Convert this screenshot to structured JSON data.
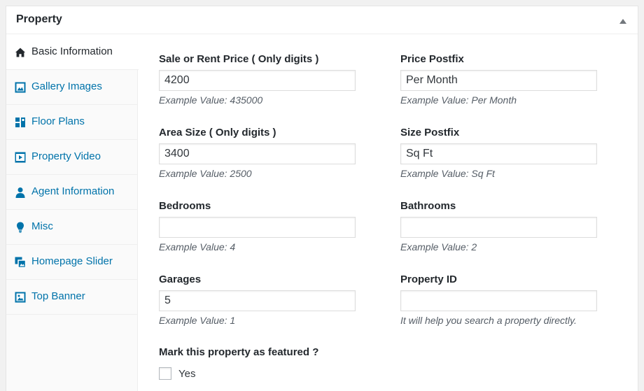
{
  "metabox": {
    "title": "Property"
  },
  "tabs": [
    {
      "label": "Basic Information",
      "icon": "home-icon",
      "active": true
    },
    {
      "label": "Gallery Images",
      "icon": "gallery-icon",
      "active": false
    },
    {
      "label": "Floor Plans",
      "icon": "floor-plan-icon",
      "active": false
    },
    {
      "label": "Property Video",
      "icon": "video-icon",
      "active": false
    },
    {
      "label": "Agent Information",
      "icon": "user-icon",
      "active": false
    },
    {
      "label": "Misc",
      "icon": "lightbulb-icon",
      "active": false
    },
    {
      "label": "Homepage Slider",
      "icon": "slider-icon",
      "active": false
    },
    {
      "label": "Top Banner",
      "icon": "image-icon",
      "active": false
    }
  ],
  "fields": {
    "price": {
      "label": "Sale or Rent Price ( Only digits )",
      "value": "4200",
      "hint": "Example Value: 435000"
    },
    "price_postfix": {
      "label": "Price Postfix",
      "value": "Per Month",
      "hint": "Example Value: Per Month"
    },
    "area": {
      "label": "Area Size ( Only digits )",
      "value": "3400",
      "hint": "Example Value: 2500"
    },
    "size_postfix": {
      "label": "Size Postfix",
      "value": "Sq Ft",
      "hint": "Example Value: Sq Ft"
    },
    "bedrooms": {
      "label": "Bedrooms",
      "value": "",
      "hint": "Example Value: 4"
    },
    "bathrooms": {
      "label": "Bathrooms",
      "value": "",
      "hint": "Example Value: 2"
    },
    "garages": {
      "label": "Garages",
      "value": "5",
      "hint": "Example Value: 1"
    },
    "property_id": {
      "label": "Property ID",
      "value": "",
      "hint": "It will help you search a property directly."
    }
  },
  "featured": {
    "label": "Mark this property as featured ?",
    "option": "Yes",
    "checked": false
  },
  "colors": {
    "link": "#0073aa",
    "text": "#23282d",
    "hint": "#555d66"
  }
}
